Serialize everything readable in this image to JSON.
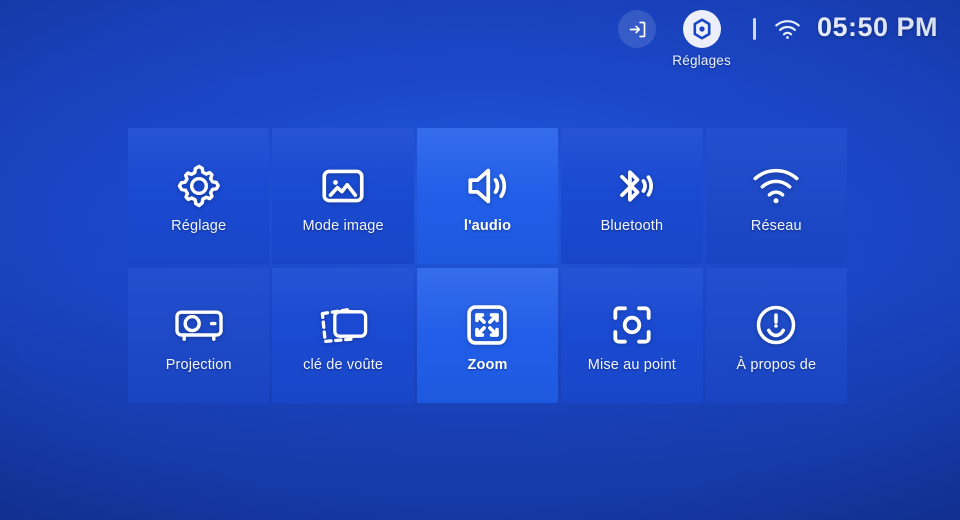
{
  "statusbar": {
    "input_icon": "input-source-icon",
    "settings_icon": "settings-hexagon-icon",
    "settings_label": "Réglages",
    "divider": "|",
    "wifi_icon": "wifi-icon",
    "time": "05:50 PM"
  },
  "grid": {
    "tiles": [
      {
        "label": "Réglage",
        "icon": "gear-icon",
        "state": "normal"
      },
      {
        "label": "Mode image",
        "icon": "picture-icon",
        "state": "normal"
      },
      {
        "label": "l'audio",
        "icon": "speaker-icon",
        "state": "focused"
      },
      {
        "label": "Bluetooth",
        "icon": "bluetooth-icon",
        "state": "normal"
      },
      {
        "label": "Réseau",
        "icon": "wifi-icon",
        "state": "dim"
      },
      {
        "label": "Projection",
        "icon": "projector-icon",
        "state": "dim"
      },
      {
        "label": "clé de voûte",
        "icon": "keystone-icon",
        "state": "normal"
      },
      {
        "label": "Zoom",
        "icon": "zoom-icon",
        "state": "focused"
      },
      {
        "label": "Mise au point",
        "icon": "focus-icon",
        "state": "normal"
      },
      {
        "label": "À propos de",
        "icon": "about-face-icon",
        "state": "dim"
      }
    ]
  },
  "colors": {
    "background": "#1a46c6",
    "tile": "#1a4ad2",
    "tile_focused": "#1f5ce8",
    "text": "#f2f5ff"
  }
}
